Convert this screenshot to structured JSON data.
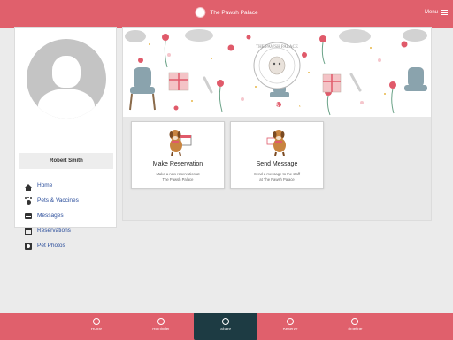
{
  "header": {
    "title": "The Pawsh Palace",
    "menu_label": "Menu"
  },
  "profile": {
    "name": "Robert Smith"
  },
  "sidebar": {
    "items": [
      {
        "label": "Home",
        "icon": "home-icon"
      },
      {
        "label": "Pets & Vaccines",
        "icon": "paw-icon"
      },
      {
        "label": "Messages",
        "icon": "mail-icon"
      },
      {
        "label": "Reservations",
        "icon": "calendar-icon"
      },
      {
        "label": "Pet Photos",
        "icon": "photo-icon"
      }
    ]
  },
  "banner": {
    "title": "The Pawsh Palace"
  },
  "cards": [
    {
      "title": "Make Reservation",
      "desc_line1": "Make a new reservation at",
      "desc_line2": "The Pawsh Palace"
    },
    {
      "title": "Send Message",
      "desc_line1": "Send a message to the staff",
      "desc_line2": "at The Pawsh Palace"
    }
  ],
  "tabbar": {
    "tabs": [
      {
        "label": "Home",
        "icon": "home-icon"
      },
      {
        "label": "Reminder",
        "icon": "reminder-icon"
      },
      {
        "label": "Share",
        "icon": "share-icon",
        "active": true
      },
      {
        "label": "Reserve",
        "icon": "plus-icon"
      },
      {
        "label": "Timeline",
        "icon": "timeline-icon"
      }
    ]
  },
  "colors": {
    "brand": "#e0606c",
    "active_tab": "#1d3b43",
    "nav_link": "#2a4d9b"
  }
}
